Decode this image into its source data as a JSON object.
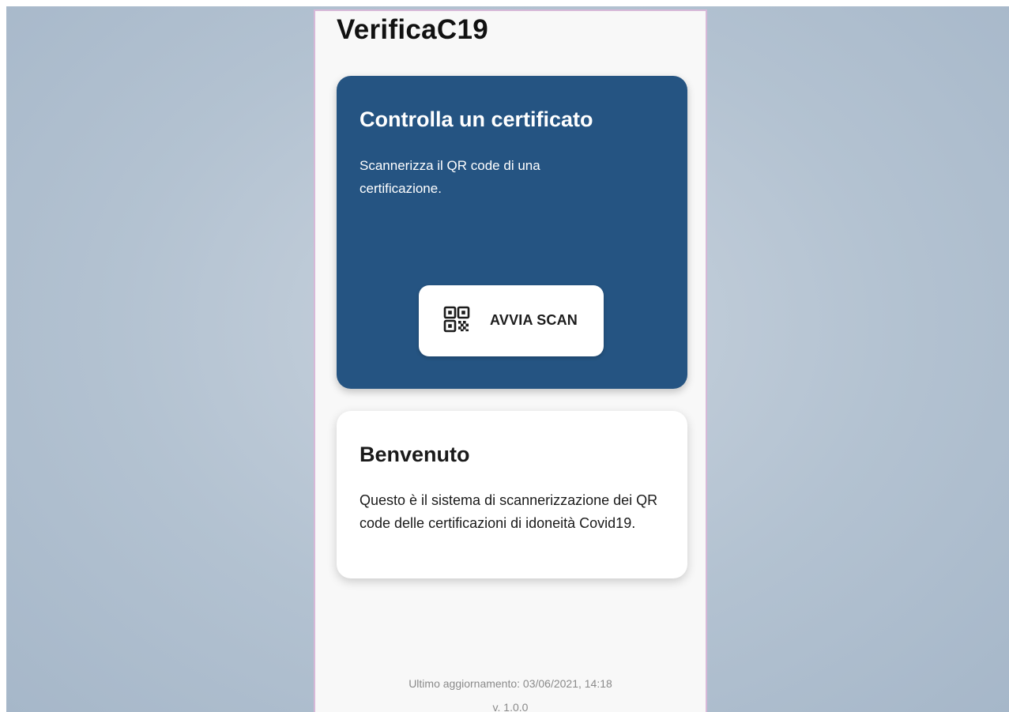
{
  "app": {
    "title": "VerificaC19"
  },
  "scan_card": {
    "title": "Controlla un certificato",
    "description": "Scannerizza il QR code di una certificazione.",
    "button_label": "AVVIA SCAN",
    "button_icon": "qr-code-icon",
    "background_color": "#255482"
  },
  "welcome_card": {
    "title": "Benvenuto",
    "description": "Questo è il sistema di scannerizzazione dei QR code delle certificazioni di idoneità Covid19."
  },
  "footer": {
    "last_update": "Ultimo aggiornamento: 03/06/2021, 14:18",
    "version": "v. 1.0.0"
  }
}
